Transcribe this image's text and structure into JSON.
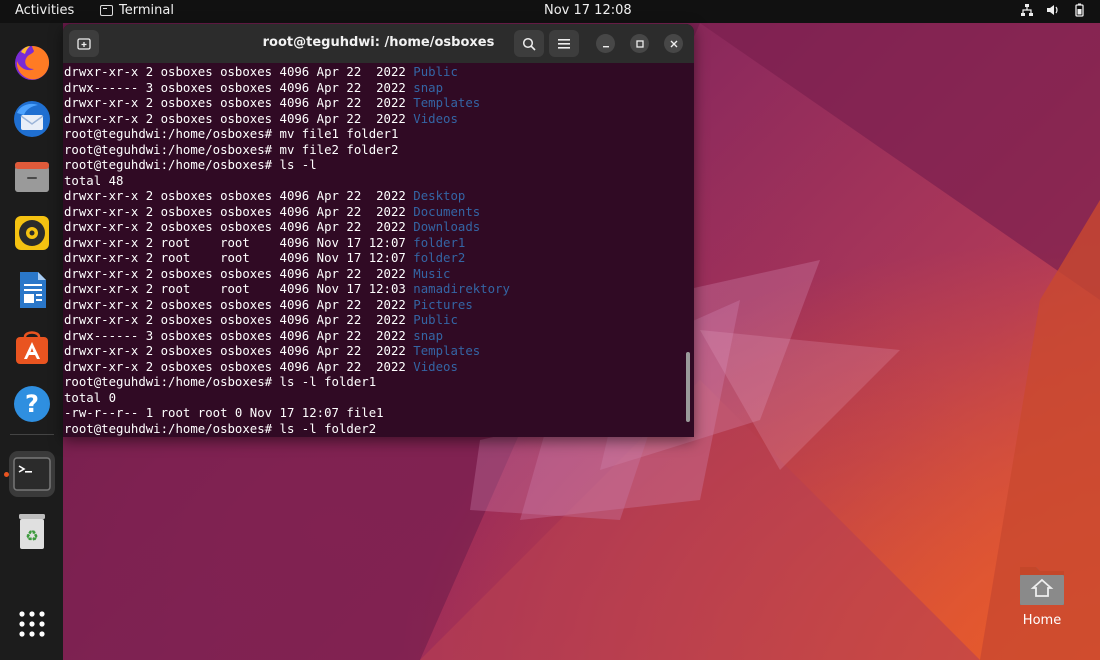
{
  "topbar": {
    "activities": "Activities",
    "app_name": "Terminal",
    "clock": "Nov 17  12:08"
  },
  "dock": {
    "items": [
      "firefox",
      "thunderbird",
      "files",
      "rhythmbox",
      "libreoffice-writer",
      "app-center",
      "help",
      "terminal",
      "trash",
      "show-apps"
    ],
    "active_color": "#e95420"
  },
  "terminal": {
    "title": "root@teguhdwi: /home/osboxes",
    "dir_color": "#3465a4",
    "lines": [
      {
        "text": "drwxr-xr-x 2 osboxes osboxes 4096 Apr 22  2022 ",
        "dir": "Public"
      },
      {
        "text": "drwx------ 3 osboxes osboxes 4096 Apr 22  2022 ",
        "dir": "snap"
      },
      {
        "text": "drwxr-xr-x 2 osboxes osboxes 4096 Apr 22  2022 ",
        "dir": "Templates"
      },
      {
        "text": "drwxr-xr-x 2 osboxes osboxes 4096 Apr 22  2022 ",
        "dir": "Videos"
      },
      {
        "text": "root@teguhdwi:/home/osboxes# mv file1 folder1",
        "dir": ""
      },
      {
        "text": "root@teguhdwi:/home/osboxes# mv file2 folder2",
        "dir": ""
      },
      {
        "text": "root@teguhdwi:/home/osboxes# ls -l",
        "dir": ""
      },
      {
        "text": "total 48",
        "dir": ""
      },
      {
        "text": "drwxr-xr-x 2 osboxes osboxes 4096 Apr 22  2022 ",
        "dir": "Desktop"
      },
      {
        "text": "drwxr-xr-x 2 osboxes osboxes 4096 Apr 22  2022 ",
        "dir": "Documents"
      },
      {
        "text": "drwxr-xr-x 2 osboxes osboxes 4096 Apr 22  2022 ",
        "dir": "Downloads"
      },
      {
        "text": "drwxr-xr-x 2 root    root    4096 Nov 17 12:07 ",
        "dir": "folder1"
      },
      {
        "text": "drwxr-xr-x 2 root    root    4096 Nov 17 12:07 ",
        "dir": "folder2"
      },
      {
        "text": "drwxr-xr-x 2 osboxes osboxes 4096 Apr 22  2022 ",
        "dir": "Music"
      },
      {
        "text": "drwxr-xr-x 2 root    root    4096 Nov 17 12:03 ",
        "dir": "namadirektory"
      },
      {
        "text": "drwxr-xr-x 2 osboxes osboxes 4096 Apr 22  2022 ",
        "dir": "Pictures"
      },
      {
        "text": "drwxr-xr-x 2 osboxes osboxes 4096 Apr 22  2022 ",
        "dir": "Public"
      },
      {
        "text": "drwx------ 3 osboxes osboxes 4096 Apr 22  2022 ",
        "dir": "snap"
      },
      {
        "text": "drwxr-xr-x 2 osboxes osboxes 4096 Apr 22  2022 ",
        "dir": "Templates"
      },
      {
        "text": "drwxr-xr-x 2 osboxes osboxes 4096 Apr 22  2022 ",
        "dir": "Videos"
      },
      {
        "text": "root@teguhdwi:/home/osboxes# ls -l folder1",
        "dir": ""
      },
      {
        "text": "total 0",
        "dir": ""
      },
      {
        "text": "-rw-r--r-- 1 root root 0 Nov 17 12:07 file1",
        "dir": ""
      },
      {
        "text": "root@teguhdwi:/home/osboxes# ls -l folder2",
        "dir": ""
      }
    ]
  },
  "desktop": {
    "home_label": "Home"
  }
}
